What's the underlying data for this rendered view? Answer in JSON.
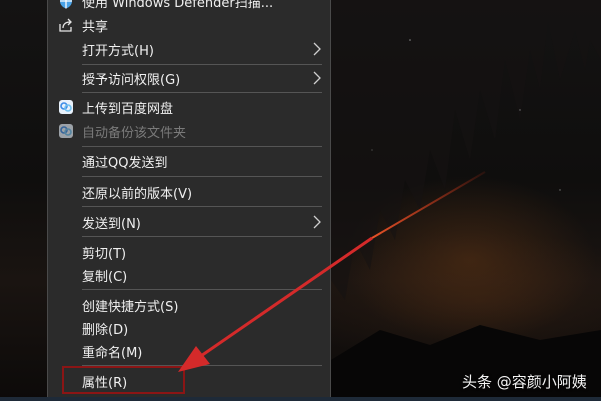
{
  "menu": {
    "items": [
      {
        "label": "使用 Windows Defender扫描...",
        "icon": "defender-shield-icon"
      },
      {
        "label": "共享",
        "icon": "share-icon"
      },
      {
        "label": "打开方式(H)",
        "submenu": true
      },
      {
        "label": "授予访问权限(G)",
        "submenu": true
      },
      {
        "label": "上传到百度网盘",
        "icon": "baidu-netdisk-icon"
      },
      {
        "label": "自动备份该文件夹",
        "icon": "baidu-netdisk-icon",
        "disabled": true
      },
      {
        "label": "通过QQ发送到"
      },
      {
        "label": "还原以前的版本(V)"
      },
      {
        "label": "发送到(N)",
        "submenu": true
      },
      {
        "label": "剪切(T)"
      },
      {
        "label": "复制(C)"
      },
      {
        "label": "创建快捷方式(S)"
      },
      {
        "label": "删除(D)"
      },
      {
        "label": "重命名(M)"
      },
      {
        "label": "属性(R)",
        "highlighted": true
      }
    ]
  },
  "watermark": "头条 @容颜小阿姨",
  "colors": {
    "menu_bg": "#2b2b2b",
    "menu_text": "#f0f0f0",
    "disabled_text": "#7a7a7a",
    "annotation_red": "#d42a2a",
    "highlight_box": "#8b1515"
  }
}
